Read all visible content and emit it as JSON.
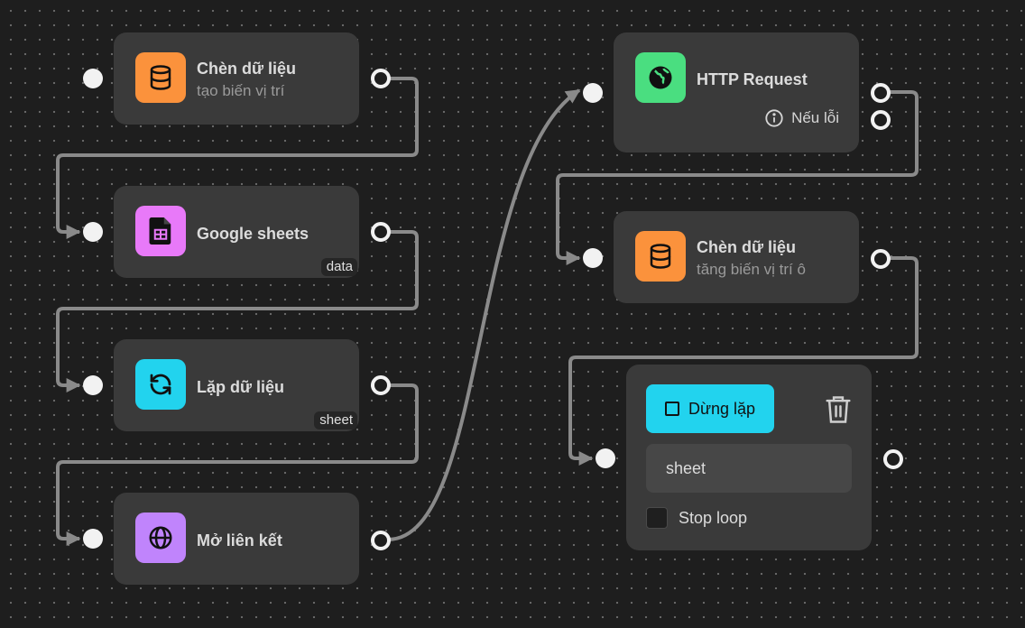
{
  "nodes": {
    "insert_data_1": {
      "title": "Chèn dữ liệu",
      "subtitle": "tạo biến vị trí",
      "icon": "database-icon",
      "color": "#fb923c"
    },
    "google_sheets": {
      "title": "Google sheets",
      "tag": "data",
      "icon": "google-sheets-icon",
      "color": "#e879f9"
    },
    "loop_data": {
      "title": "Lặp dữ liệu",
      "tag": "sheet",
      "icon": "loop-arrows-icon",
      "color": "#22d3ee"
    },
    "open_link": {
      "title": "Mở liên kết",
      "icon": "globe-icon",
      "color": "#c084fc"
    },
    "http_request": {
      "title": "HTTP Request",
      "error_label": "Nếu lỗi",
      "icon": "globe-filled-icon",
      "color": "#4ade80"
    },
    "insert_data_2": {
      "title": "Chèn dữ liệu",
      "subtitle": "tăng biến vị trí ô",
      "icon": "database-icon",
      "color": "#fb923c"
    },
    "stop_loop": {
      "button_label": "Dừng lặp",
      "button_color": "#22d3ee",
      "field_value": "sheet",
      "checkbox_label": "Stop loop",
      "checkbox_checked": false
    }
  },
  "colors": {
    "canvas": "#1e1e1e",
    "node": "#3a3a3a",
    "edge": "#8a8a8a",
    "port": "#f2f2f2"
  }
}
